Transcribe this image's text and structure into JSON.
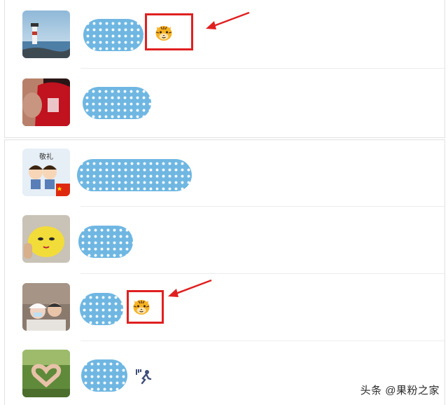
{
  "contacts": [
    {
      "avatar": "lighthouse-photo",
      "name": "",
      "emoji": "tiger-face",
      "highlighted": true
    },
    {
      "avatar": "man-red-shirt-photo",
      "name": "",
      "emoji": null,
      "highlighted": false
    },
    {
      "avatar": "cartoon-salute-with-flag",
      "name": "",
      "emoji": null,
      "highlighted": false,
      "avatar_caption": "敬礼"
    },
    {
      "avatar": "lemon-face-photo",
      "name": "",
      "emoji": null,
      "highlighted": false
    },
    {
      "avatar": "couple-selfie-photo",
      "name": "",
      "emoji": "tiger-face",
      "highlighted": true
    },
    {
      "avatar": "heart-hands-photo",
      "name": "",
      "emoji": "runner-icon",
      "highlighted": false
    }
  ],
  "annotation_color": "#e02020",
  "blur_color": "#6fb7e2",
  "watermark": "头条 @果粉之家"
}
